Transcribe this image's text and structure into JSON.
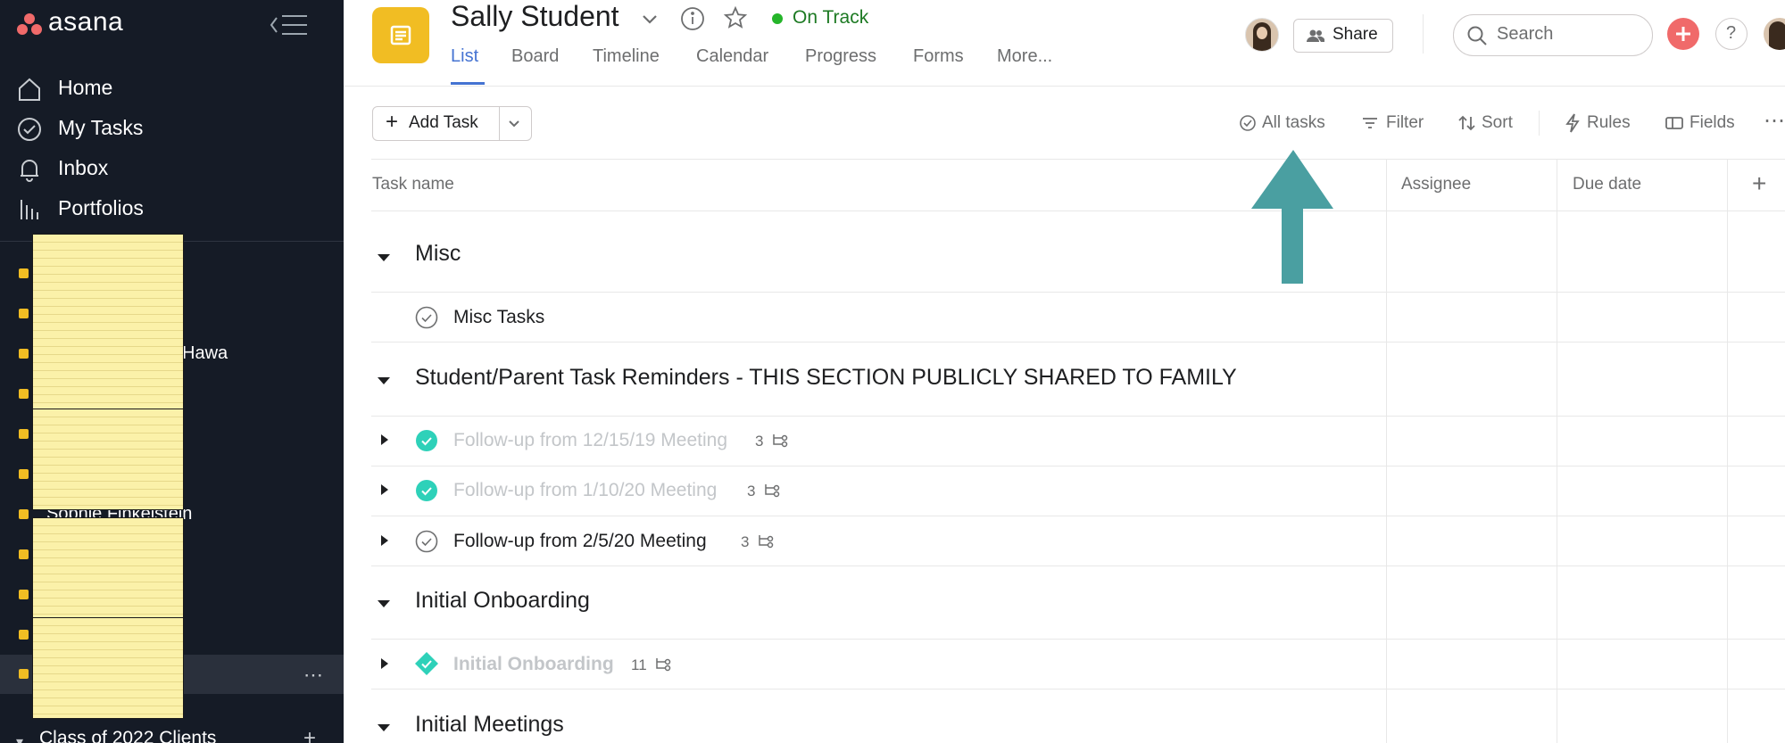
{
  "app": {
    "logo": "asana"
  },
  "sidebar": {
    "nav": [
      {
        "label": "Home",
        "icon": "home-icon"
      },
      {
        "label": "My Tasks",
        "icon": "check-circle-icon"
      },
      {
        "label": "Inbox",
        "icon": "bell-icon"
      },
      {
        "label": "Portfolios",
        "icon": "bar-chart-icon"
      }
    ],
    "project_fragments": [
      "Hawa",
      "Sophie Finkelstein"
    ],
    "team_label": "Class of 2022 Clients"
  },
  "header": {
    "title": "Sally Student",
    "status": "On Track",
    "status_color": "#25b52a",
    "tabs": [
      "List",
      "Board",
      "Timeline",
      "Calendar",
      "Progress",
      "Forms",
      "More..."
    ],
    "active_tab": "List",
    "share_label": "Share",
    "search_placeholder": "Search"
  },
  "toolbar": {
    "add_task_label": "Add Task",
    "all_tasks_label": "All tasks",
    "filter_label": "Filter",
    "sort_label": "Sort",
    "rules_label": "Rules",
    "fields_label": "Fields"
  },
  "columns": {
    "task_name": "Task name",
    "assignee": "Assignee",
    "due_date": "Due date"
  },
  "sections": [
    {
      "title": "Misc",
      "tasks": [
        {
          "name": "Misc Tasks",
          "completed": false,
          "subtasks": ""
        }
      ]
    },
    {
      "title": "Student/Parent Task Reminders - THIS SECTION PUBLICLY SHARED TO FAMILY",
      "tasks": [
        {
          "name": "Follow-up from 12/15/19 Meeting",
          "completed": true,
          "subtasks": "3"
        },
        {
          "name": "Follow-up from 1/10/20 Meeting",
          "completed": true,
          "subtasks": "3"
        },
        {
          "name": "Follow-up from 2/5/20 Meeting",
          "completed": false,
          "subtasks": "3"
        }
      ]
    },
    {
      "title": "Initial Onboarding",
      "tasks": [
        {
          "name": "Initial Onboarding",
          "completed": true,
          "milestone": true,
          "subtasks": "11"
        }
      ]
    },
    {
      "title": "Initial Meetings",
      "tasks": []
    }
  ],
  "annotation": {
    "arrow_color": "#4a9fa1",
    "points_to": "All tasks"
  }
}
